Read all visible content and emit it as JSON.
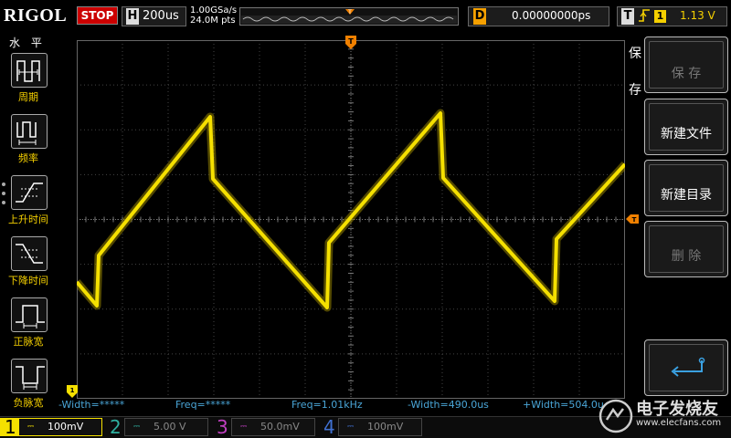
{
  "top": {
    "brand": "RIGOL",
    "run_state": "STOP",
    "horizontal_label": "H",
    "timebase": "200us",
    "sample_rate": "1.00GSa/s",
    "memory_depth": "24.0M pts",
    "delay_label": "D",
    "delay_value": "0.00000000ps",
    "trigger_label": "T",
    "trigger_edge": "rising-edge-icon",
    "trigger_source": "1",
    "trigger_level": "1.13 V"
  },
  "left_menu": {
    "title": "水 平",
    "items": [
      {
        "label": "周期",
        "icon": "period-icon"
      },
      {
        "label": "频率",
        "icon": "frequency-icon"
      },
      {
        "label": "上升时间",
        "icon": "rise-time-icon"
      },
      {
        "label": "下降时间",
        "icon": "fall-time-icon"
      },
      {
        "label": "正脉宽",
        "icon": "positive-width-icon"
      },
      {
        "label": "负脉宽",
        "icon": "negative-width-icon"
      }
    ]
  },
  "right_menu": {
    "caption_1": "保",
    "caption_2": "存",
    "buttons": [
      {
        "label": "保 存",
        "enabled": false
      },
      {
        "label": "新建文件",
        "enabled": true
      },
      {
        "label": "新建目录",
        "enabled": true
      },
      {
        "label": "删 除",
        "enabled": false
      },
      {
        "label": "",
        "icon": "return-icon",
        "enabled": true
      }
    ]
  },
  "measurements": [
    "-Width=*****",
    "Freq=*****",
    "Freq=1.01kHz",
    "-Width=490.0us",
    "+Width=504.0u"
  ],
  "channels": [
    {
      "num": "1",
      "value": "100mV",
      "color": "#f5e000",
      "active": true
    },
    {
      "num": "2",
      "value": "5.00 V",
      "color": "#2fb0a0",
      "active": false
    },
    {
      "num": "3",
      "value": "50.0mV",
      "color": "#c040c0",
      "active": false
    },
    {
      "num": "4",
      "value": "100mV",
      "color": "#4070d0",
      "active": false
    }
  ],
  "watermark": {
    "title": "电子发烧友",
    "url": "www.elecfans.com"
  },
  "colors": {
    "trace": "#f5e000",
    "marker": "#f08000",
    "measure_text": "#4aa6d8"
  }
}
